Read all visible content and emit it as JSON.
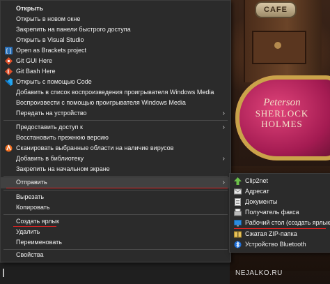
{
  "context_menu": {
    "items": [
      {
        "label": "Открыть",
        "bold": true,
        "icon": "",
        "submenu": false
      },
      {
        "label": "Открыть в новом окне",
        "icon": "",
        "submenu": false
      },
      {
        "label": "Закрепить на панели быстрого доступа",
        "icon": "",
        "submenu": false
      },
      {
        "label": "Открыть в Visual Studio",
        "icon": "",
        "submenu": false
      },
      {
        "label": "Open as Brackets project",
        "icon": "brackets-icon",
        "submenu": false
      },
      {
        "label": "Git GUI Here",
        "icon": "git-gui-icon",
        "submenu": false
      },
      {
        "label": "Git Bash Here",
        "icon": "git-bash-icon",
        "submenu": false
      },
      {
        "label": "Открыть с помощью Code",
        "icon": "vscode-icon",
        "submenu": false
      },
      {
        "label": "Добавить в список воспроизведения проигрывателя Windows Media",
        "icon": "",
        "submenu": false
      },
      {
        "label": "Воспроизвести с помощью проигрывателя Windows Media",
        "icon": "",
        "submenu": false
      },
      {
        "label": "Передать на устройство",
        "icon": "",
        "submenu": true
      },
      {
        "label": "Предоставить доступ к",
        "icon": "",
        "submenu": true
      },
      {
        "label": "Восстановить прежнюю версию",
        "icon": "",
        "submenu": false
      },
      {
        "label": "Сканировать выбранные области на наличие вирусов",
        "icon": "avast-icon",
        "submenu": false
      },
      {
        "label": "Добавить в библиотеку",
        "icon": "",
        "submenu": true
      },
      {
        "label": "Закрепить на начальном экране",
        "icon": "",
        "submenu": false
      },
      {
        "label": "Отправить",
        "icon": "",
        "submenu": true,
        "selected": true
      },
      {
        "label": "Вырезать",
        "icon": "",
        "submenu": false
      },
      {
        "label": "Копировать",
        "icon": "",
        "submenu": false
      },
      {
        "label": "Создать ярлык",
        "icon": "",
        "submenu": false
      },
      {
        "label": "Удалить",
        "icon": "",
        "submenu": false
      },
      {
        "label": "Переименовать",
        "icon": "",
        "submenu": false
      },
      {
        "label": "Свойства",
        "icon": "",
        "submenu": false
      }
    ]
  },
  "send_to_submenu": {
    "items": [
      {
        "label": "Clip2net",
        "icon": "clip2net-icon"
      },
      {
        "label": "Адресат",
        "icon": "mail-recipient-icon"
      },
      {
        "label": "Документы",
        "icon": "documents-icon"
      },
      {
        "label": "Получатель факса",
        "icon": "fax-icon"
      },
      {
        "label": "Рабочий стол (создать ярлык)",
        "icon": "desktop-icon"
      },
      {
        "label": "Сжатая ZIP-папка",
        "icon": "zip-folder-icon"
      },
      {
        "label": "Устройство Bluetooth",
        "icon": "bluetooth-icon"
      }
    ]
  },
  "background": {
    "cafe_sign": "CAFE",
    "tin_label_1": "Peterson",
    "tin_label_2": "SHERLOCK",
    "tin_label_3": "HOLMES"
  },
  "watermark": "NEJALKO.RU",
  "colors": {
    "menu_bg": "#2b2b2b",
    "menu_text": "#f0f0f0",
    "selected_bg": "#414141",
    "annotation_underline": "#dd2222"
  }
}
